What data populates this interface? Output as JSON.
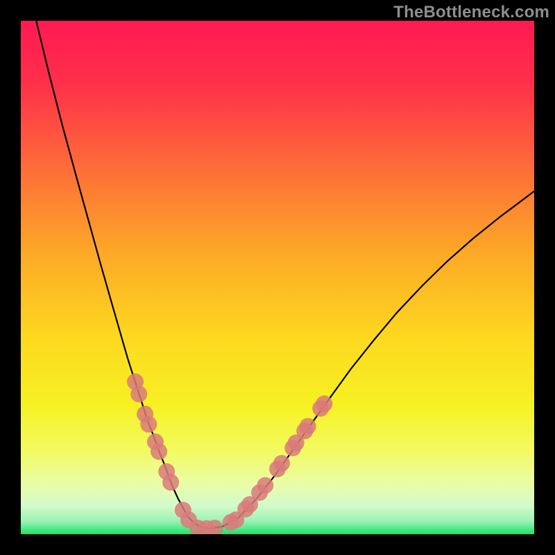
{
  "watermark_text": "TheBottleneck.com",
  "chart_data": {
    "type": "line",
    "title": "",
    "xlabel": "",
    "ylabel": "",
    "xlim": [
      0,
      100
    ],
    "ylim": [
      0,
      100
    ],
    "grid": false,
    "legend": false,
    "background_gradient_stops": [
      {
        "offset": 0.0,
        "color": "#ff1a52"
      },
      {
        "offset": 0.12,
        "color": "#ff2f4a"
      },
      {
        "offset": 0.28,
        "color": "#fd6a3a"
      },
      {
        "offset": 0.45,
        "color": "#fda827"
      },
      {
        "offset": 0.62,
        "color": "#fdd91f"
      },
      {
        "offset": 0.75,
        "color": "#f7f123"
      },
      {
        "offset": 0.84,
        "color": "#f2fb63"
      },
      {
        "offset": 0.9,
        "color": "#eafca6"
      },
      {
        "offset": 0.945,
        "color": "#d3facb"
      },
      {
        "offset": 0.975,
        "color": "#9af2b4"
      },
      {
        "offset": 1.0,
        "color": "#18e46a"
      }
    ],
    "curve_color": "#000000",
    "curve_width": 2.2,
    "dot_color": "#d97a7a",
    "dot_opacity": 0.85,
    "dot_radius": 12,
    "series": [
      {
        "name": "bottleneck-curve",
        "x": [
          3.0,
          5.4,
          8.1,
          10.8,
          13.3,
          15.6,
          17.6,
          19.3,
          20.8,
          22.2,
          23.5,
          24.6,
          25.8,
          26.8,
          27.8,
          28.7,
          29.5,
          30.6,
          31.6,
          32.4,
          33.5,
          34.9,
          36.8,
          39.3,
          42.3,
          45.9,
          49.3,
          53.0,
          56.8,
          60.6,
          64.3,
          68.6,
          73.2,
          78.1,
          83.0,
          88.1,
          93.2,
          98.4,
          100.0
        ],
        "y": [
          100.0,
          90.1,
          79.6,
          69.7,
          60.7,
          52.4,
          45.4,
          39.5,
          34.3,
          29.9,
          25.9,
          22.4,
          19.3,
          16.5,
          14.0,
          11.6,
          9.4,
          7.0,
          5.1,
          3.6,
          2.4,
          1.5,
          1.1,
          1.5,
          3.1,
          6.9,
          11.2,
          16.4,
          21.8,
          27.1,
          32.2,
          37.6,
          43.1,
          48.3,
          53.1,
          57.6,
          61.7,
          65.6,
          66.8
        ]
      }
    ],
    "annotations": [
      {
        "name": "left-branch-dots",
        "points": [
          {
            "x": 22.3,
            "y": 29.7
          },
          {
            "x": 23.0,
            "y": 27.3
          },
          {
            "x": 24.2,
            "y": 23.4
          },
          {
            "x": 24.9,
            "y": 21.4
          },
          {
            "x": 26.2,
            "y": 18.0
          },
          {
            "x": 26.9,
            "y": 16.1
          },
          {
            "x": 28.4,
            "y": 12.2
          },
          {
            "x": 29.2,
            "y": 10.1
          }
        ]
      },
      {
        "name": "trough-dots",
        "points": [
          {
            "x": 31.6,
            "y": 4.7
          },
          {
            "x": 32.7,
            "y": 2.8
          },
          {
            "x": 34.5,
            "y": 1.2
          },
          {
            "x": 36.2,
            "y": 1.1
          },
          {
            "x": 37.8,
            "y": 1.2
          }
        ]
      },
      {
        "name": "right-branch-dots",
        "points": [
          {
            "x": 40.9,
            "y": 2.3
          },
          {
            "x": 41.9,
            "y": 2.8
          },
          {
            "x": 43.8,
            "y": 4.9
          },
          {
            "x": 44.6,
            "y": 5.8
          },
          {
            "x": 46.5,
            "y": 8.1
          },
          {
            "x": 47.6,
            "y": 9.5
          },
          {
            "x": 50.0,
            "y": 12.7
          },
          {
            "x": 50.8,
            "y": 13.8
          },
          {
            "x": 53.0,
            "y": 16.8
          },
          {
            "x": 53.6,
            "y": 17.8
          },
          {
            "x": 55.3,
            "y": 20.1
          },
          {
            "x": 55.9,
            "y": 21.0
          },
          {
            "x": 58.4,
            "y": 24.5
          },
          {
            "x": 59.1,
            "y": 25.4
          }
        ]
      }
    ]
  }
}
